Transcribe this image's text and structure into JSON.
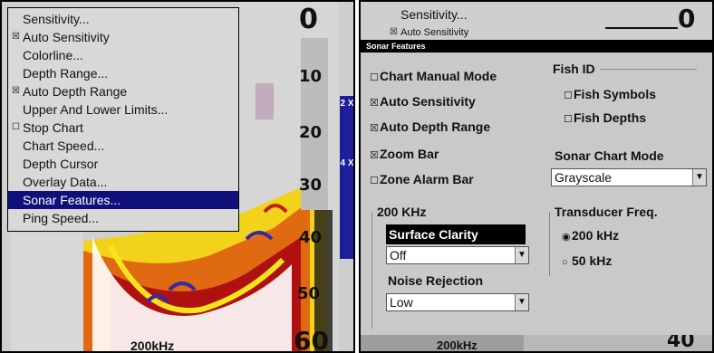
{
  "left_screen": {
    "menu": [
      {
        "label": "Sensitivity...",
        "checked": false,
        "has_checkbox": false
      },
      {
        "label": "Auto Sensitivity",
        "checked": true,
        "has_checkbox": true
      },
      {
        "label": "Colorline...",
        "checked": false,
        "has_checkbox": false
      },
      {
        "label": "Depth Range...",
        "checked": false,
        "has_checkbox": false
      },
      {
        "label": "Auto Depth Range",
        "checked": true,
        "has_checkbox": true
      },
      {
        "label": "Upper And Lower Limits...",
        "checked": false,
        "has_checkbox": false
      },
      {
        "label": "Stop Chart",
        "checked": false,
        "has_checkbox": true
      },
      {
        "label": "Chart Speed...",
        "checked": false,
        "has_checkbox": false
      },
      {
        "label": "Depth Cursor",
        "checked": false,
        "has_checkbox": false
      },
      {
        "label": "Overlay Data...",
        "checked": false,
        "has_checkbox": false
      },
      {
        "label": "Sonar Features...",
        "checked": false,
        "has_checkbox": false,
        "selected": true
      },
      {
        "label": "Ping Speed...",
        "checked": false,
        "has_checkbox": false
      }
    ],
    "depth_labels": [
      "0",
      "10",
      "20",
      "30",
      "40",
      "50",
      "60"
    ],
    "zoom_2x": "2 X",
    "zoom_4x": "4 X",
    "frequency": "200kHz"
  },
  "right_screen": {
    "behind_menu": [
      "Sensitivity...",
      "Auto Sensitivity"
    ],
    "depth_top": "0",
    "depth_bottom": "40",
    "frequency": "200kHz",
    "dialog": {
      "title": "Sonar Features",
      "checkboxes": [
        {
          "label": "Chart Manual Mode",
          "checked": false
        },
        {
          "label": "Auto Sensitivity",
          "checked": true
        },
        {
          "label": "Auto Depth Range",
          "checked": true
        },
        {
          "label": "Zoom Bar",
          "checked": true
        },
        {
          "label": "Zone Alarm Bar",
          "checked": false
        }
      ],
      "fish_id": {
        "heading": "Fish ID",
        "options": [
          {
            "label": "Fish Symbols",
            "checked": false
          },
          {
            "label": "Fish Depths",
            "checked": false
          }
        ]
      },
      "sonar_chart_mode": {
        "heading": "Sonar Chart Mode",
        "value": "Grayscale"
      },
      "khz_group": {
        "heading": "200 KHz",
        "surface_clarity": {
          "label": "Surface Clarity",
          "value": "Off"
        },
        "noise_rejection": {
          "label": "Noise Rejection",
          "value": "Low"
        }
      },
      "transducer": {
        "heading": "Transducer Freq.",
        "options": [
          {
            "label": "200 kHz",
            "selected": true
          },
          {
            "label": "50 kHz",
            "selected": false
          }
        ]
      }
    }
  },
  "icons": {
    "checked": "☒",
    "unchecked": "☐",
    "radio_on": "◉",
    "radio_off": "○",
    "dropdown": "▼"
  }
}
